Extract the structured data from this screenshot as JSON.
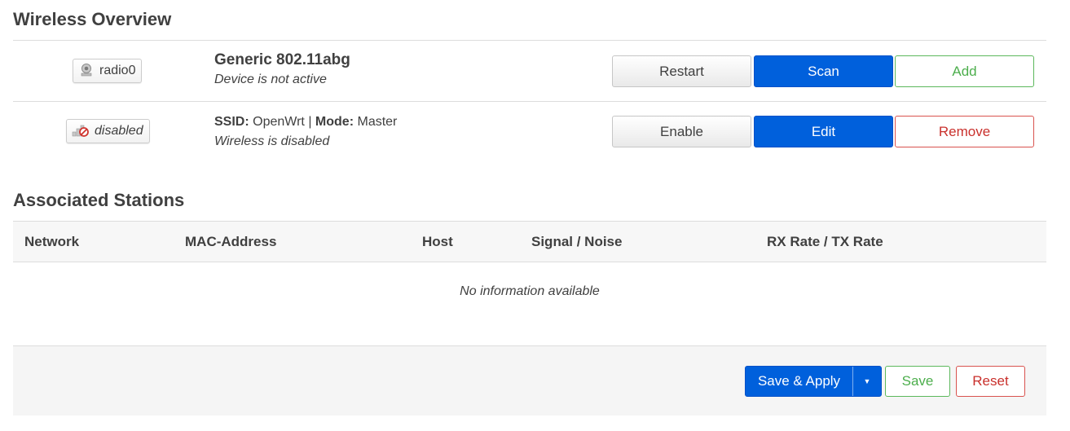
{
  "overview": {
    "title": "Wireless Overview",
    "device": {
      "badge_label": "radio0",
      "badge_icon": "wifi-radio-icon",
      "name": "Generic 802.11abg",
      "status": "Device is not active",
      "buttons": {
        "restart": "Restart",
        "scan": "Scan",
        "add": "Add"
      }
    },
    "network": {
      "badge_label": "disabled",
      "badge_icon": "signal-disabled-icon",
      "ssid_label": "SSID:",
      "ssid_value": "OpenWrt",
      "separator": "|",
      "mode_label": "Mode:",
      "mode_value": "Master",
      "status": "Wireless is disabled",
      "buttons": {
        "enable": "Enable",
        "edit": "Edit",
        "remove": "Remove"
      }
    }
  },
  "stations": {
    "title": "Associated Stations",
    "columns": [
      "Network",
      "MAC-Address",
      "Host",
      "Signal / Noise",
      "RX Rate / TX Rate"
    ],
    "empty_text": "No information available"
  },
  "footer": {
    "save_apply": "Save & Apply",
    "save": "Save",
    "reset": "Reset"
  },
  "colors": {
    "primary": "#0060dc",
    "positive": "#4cae4c",
    "negative": "#c9302c"
  }
}
